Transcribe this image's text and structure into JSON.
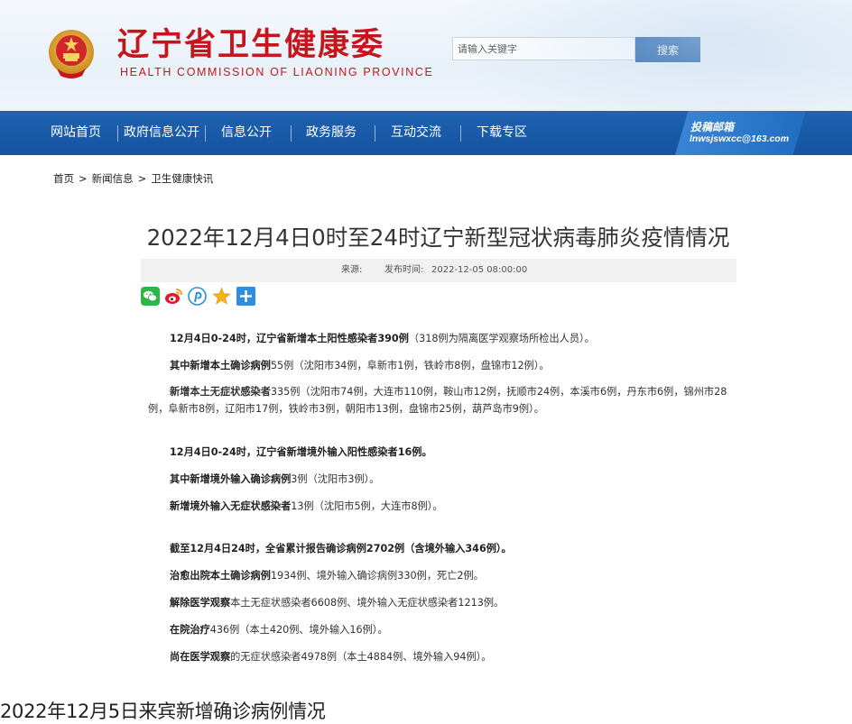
{
  "header": {
    "title": "辽宁省卫生健康委",
    "subtitle": "HEALTH COMMISSION OF LIAONING PROVINCE",
    "emblem_icon": "national-emblem-icon",
    "brand_color": "#c4161c"
  },
  "search": {
    "placeholder": "请输入关键字",
    "button_label": "搜索"
  },
  "nav": {
    "items": [
      {
        "label": "网站首页"
      },
      {
        "label": "政府信息公开"
      },
      {
        "label": "信息公开"
      },
      {
        "label": "政务服务"
      },
      {
        "label": "互动交流"
      },
      {
        "label": "下载专区"
      }
    ],
    "mailbox_title": "投稿邮箱",
    "mailbox_email": "lnwsjswxcc@163.com",
    "color": "#1f63b1"
  },
  "breadcrumb": [
    "首页",
    "新闻信息",
    "卫生健康快讯"
  ],
  "breadcrumb_separator": ">",
  "article": {
    "title": "2022年12月4日0时至24时辽宁新型冠状病毒肺炎疫情情况",
    "source_label": "来源:",
    "date_label": "发布时间:",
    "date_value": "2022-12-05 08:00:00",
    "share_icons": [
      "wechat-icon",
      "weibo-icon",
      "pinterest-icon",
      "favorite-star-icon",
      "more-plus-icon"
    ],
    "p1_bold": "12月4日0-24时，辽宁省新增本土阳性感染者390例",
    "p1_rest": "（318例为隔离医学观察场所检出人员）。",
    "p2_bold": "其中新增本土确诊病例",
    "p2_rest": "55例（沈阳市34例，阜新市1例，铁岭市8例，盘锦市12例）。",
    "p3_bold": "新增本土无症状感染者",
    "p3_rest": "335例（沈阳市74例，大连市110例，鞍山市12例，抚顺市24例，本溪市6例，丹东市6例，锦州市28例，阜新市8例，辽阳市17例，铁岭市3例，朝阳市13例，盘锦市25例，葫芦岛市9例）。",
    "p4_bold": "12月4日0-24时，辽宁省新增境外输入阳性感染者16例。",
    "p5_bold": "其中新增境外输入确诊病例",
    "p5_rest": "3例（沈阳市3例）。",
    "p6_bold": "新增境外输入无症状感染者",
    "p6_rest": "13例（沈阳市5例，大连市8例）。",
    "p7_bold": "截至12月4日24时，全省累计报告确诊病例2702例（含境外输入346例）。",
    "p8_bold": "治愈出院本土确诊病例",
    "p8_rest": "1934例、境外输入确诊病例330例，死亡2例。",
    "p9_bold": "解除医学观察",
    "p9_rest": "本土无症状感染者6608例、境外输入无症状感染者1213例。",
    "p10_bold": "在院治疗",
    "p10_rest": "436例（本土420例、境外输入16例）。",
    "p11_bold": "尚在医学观察",
    "p11_rest": "的无症状感染者4978例（本土4884例、境外输入94例）。"
  },
  "caption": "2022年12月5日来宾新增确诊病例情况"
}
